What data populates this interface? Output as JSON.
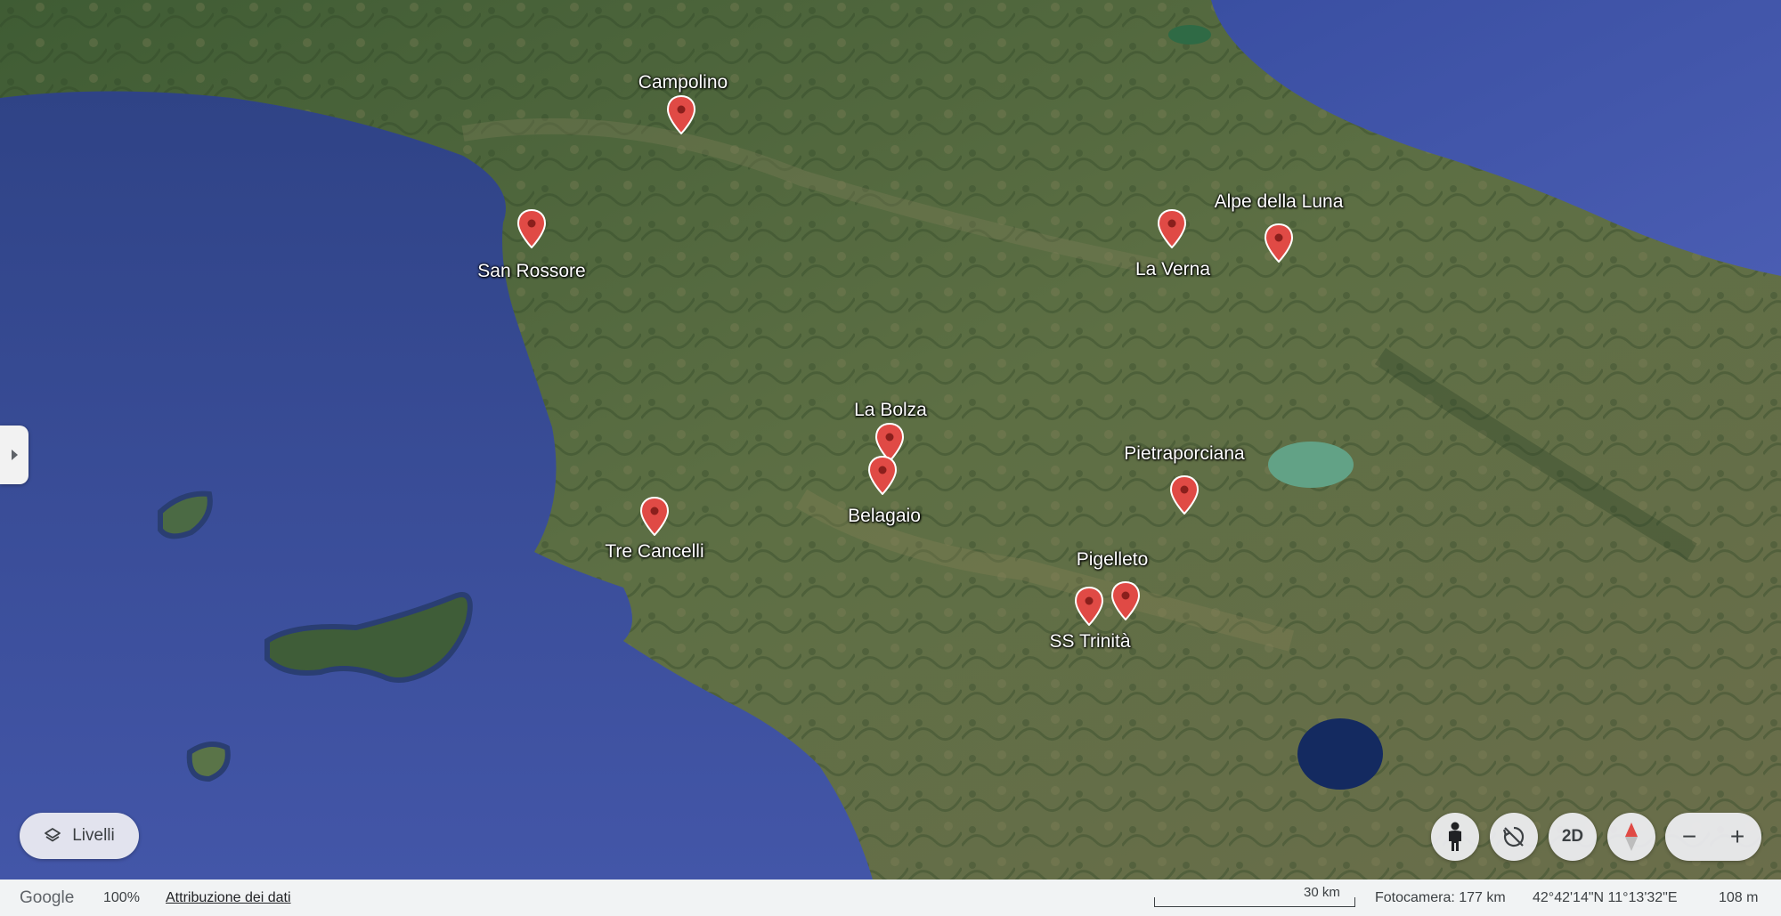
{
  "places": [
    {
      "name": "Campolino"
    },
    {
      "name": "San Rossore"
    },
    {
      "name": "Alpe della Luna"
    },
    {
      "name": "La Verna"
    },
    {
      "name": "La Bolza"
    },
    {
      "name": "Belagaio"
    },
    {
      "name": "Pietraporciana"
    },
    {
      "name": "Tre Cancelli"
    },
    {
      "name": "Pigelleto"
    },
    {
      "name": "SS Trinità"
    }
  ],
  "controls": {
    "layers_label": "Livelli",
    "view_2d_label": "2D",
    "zoom_out_symbol": "−",
    "zoom_in_symbol": "+"
  },
  "footer": {
    "brand": "Google",
    "zoom_percent": "100%",
    "attribution": "Attribuzione dei dati",
    "scale": "30 km",
    "camera": "Fotocamera: 177 km",
    "coordinates": "42°42'14\"N 11°13'32\"E",
    "elevation": "108 m"
  },
  "icons": {
    "pin": "map-pin-icon",
    "layers": "layers-icon",
    "pegman": "street-view-icon",
    "rotate": "rotate-off-icon",
    "compass": "compass-icon",
    "expand": "chevron-right-icon"
  },
  "colors": {
    "pin": "#e04a45",
    "sea": "#3b4f9e",
    "land": "#4c6b3a"
  }
}
